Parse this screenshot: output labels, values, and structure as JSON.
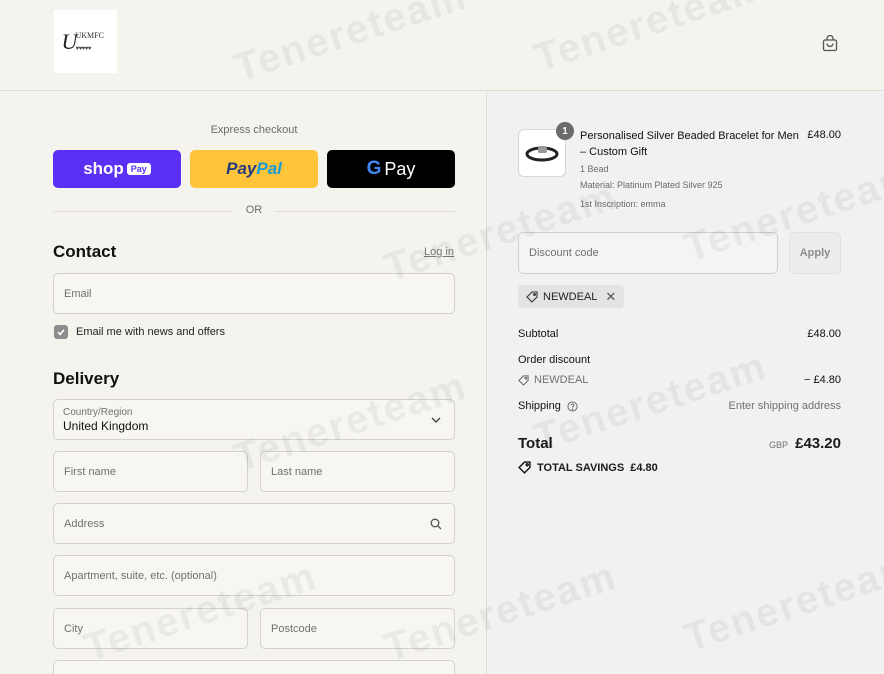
{
  "header": {
    "logo_text": "UKMFC",
    "cart_icon": "shopping-bag-icon"
  },
  "express": {
    "title": "Express checkout",
    "shop_pay": {
      "shop": "shop",
      "pay": "Pay"
    },
    "paypal": {
      "part1": "Pay",
      "part2": "Pal"
    },
    "gpay": {
      "g": "G",
      "pay": "Pay"
    },
    "or": "OR"
  },
  "contact": {
    "title": "Contact",
    "login_link": "Log in",
    "email_placeholder": "Email",
    "newsletter_label": "Email me with news and offers",
    "newsletter_checked": true
  },
  "delivery": {
    "title": "Delivery",
    "country_label": "Country/Region",
    "country_value": "United Kingdom",
    "first_name_placeholder": "First name",
    "last_name_placeholder": "Last name",
    "address_placeholder": "Address",
    "apartment_placeholder": "Apartment, suite, etc. (optional)",
    "city_placeholder": "City",
    "postcode_placeholder": "Postcode"
  },
  "order": {
    "item": {
      "quantity": "1",
      "title": "Personalised Silver Beaded Bracelet for Men – Custom Gift",
      "price": "£48.00",
      "meta": [
        "1 Bead",
        "Material: Platinum Plated Silver 925",
        "1st Inscription: emma"
      ]
    },
    "discount_placeholder": "Discount code",
    "apply_label": "Apply",
    "applied_code": "NEWDEAL",
    "subtotal_label": "Subtotal",
    "subtotal_value": "£48.00",
    "order_discount_label": "Order discount",
    "discount_code_label": "NEWDEAL",
    "discount_value": "− £4.80",
    "shipping_label": "Shipping",
    "shipping_value": "Enter shipping address",
    "total_label": "Total",
    "currency": "GBP",
    "total_value": "£43.20",
    "total_savings_label": "TOTAL SAVINGS",
    "total_savings_value": "£4.80"
  },
  "watermark": "Tenereteam",
  "colors": {
    "shop_pay": "#5a31f4",
    "paypal": "#ffc439",
    "gpay": "#000000",
    "page_bg": "#f4f3ee",
    "summary_bg": "#f1f1f1"
  }
}
